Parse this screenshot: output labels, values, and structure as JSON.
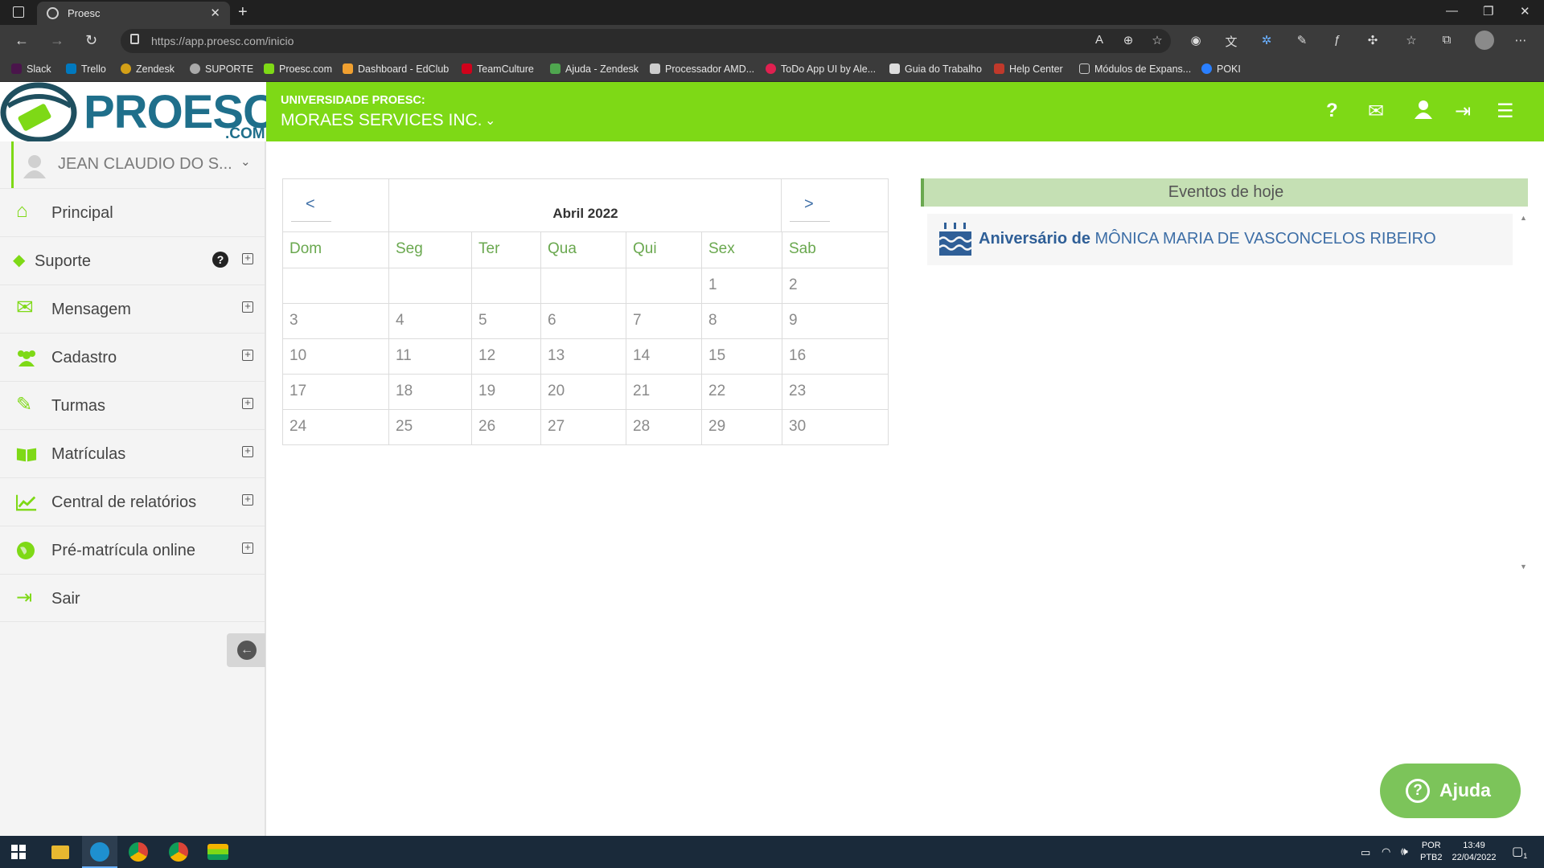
{
  "browser": {
    "tab_title": "Proesc",
    "url": "https://app.proesc.com/inicio",
    "bookmarks": [
      "Slack",
      "Trello",
      "Zendesk",
      "SUPORTE",
      "Proesc.com",
      "Dashboard - EdClub",
      "TeamCulture",
      "Ajuda - Zendesk",
      "Processador AMD...",
      "ToDo App UI by Ale...",
      "Guia do Trabalho",
      "Help Center",
      "Módulos de Expans...",
      "POKI"
    ]
  },
  "header": {
    "logo_text": "PROESC",
    "logo_sub": ".COM",
    "university_label": "UNIVERSIDADE PROESC:",
    "company": "MORAES SERVICES INC."
  },
  "sidebar": {
    "user_name": "JEAN CLAUDIO DO S...",
    "items": [
      {
        "label": "Principal"
      },
      {
        "label": "Suporte"
      },
      {
        "label": "Mensagem"
      },
      {
        "label": "Cadastro"
      },
      {
        "label": "Turmas"
      },
      {
        "label": "Matrículas"
      },
      {
        "label": "Central de relatórios"
      },
      {
        "label": "Pré-matrícula online"
      },
      {
        "label": "Sair"
      }
    ]
  },
  "calendar": {
    "prev": "<",
    "next": ">",
    "month_title": "Abril 2022",
    "weekdays": [
      "Dom",
      "Seg",
      "Ter",
      "Qua",
      "Qui",
      "Sex",
      "Sab"
    ],
    "weeks": [
      [
        "",
        "",
        "",
        "",
        "",
        "1",
        "2"
      ],
      [
        "3",
        "4",
        "5",
        "6",
        "7",
        "8",
        "9"
      ],
      [
        "10",
        "11",
        "12",
        "13",
        "14",
        "15",
        "16"
      ],
      [
        "17",
        "18",
        "19",
        "20",
        "21",
        "22",
        "23"
      ],
      [
        "24",
        "25",
        "26",
        "27",
        "28",
        "29",
        "30"
      ]
    ]
  },
  "events": {
    "title": "Eventos de hoje",
    "items": [
      {
        "prefix": "Aniversário de",
        "name": "MÔNICA MARIA DE VASCONCELOS RIBEIRO"
      }
    ]
  },
  "help_button": "Ajuda",
  "taskbar": {
    "lang1": "POR",
    "lang2": "PTB2",
    "time": "13:49",
    "date": "22/04/2022",
    "notifications": "1"
  },
  "colors": {
    "brand_green": "#7ed916",
    "header_blue": "#1f6f8b",
    "event_head": "#c5e0b4",
    "help_green": "#7cc45a"
  }
}
